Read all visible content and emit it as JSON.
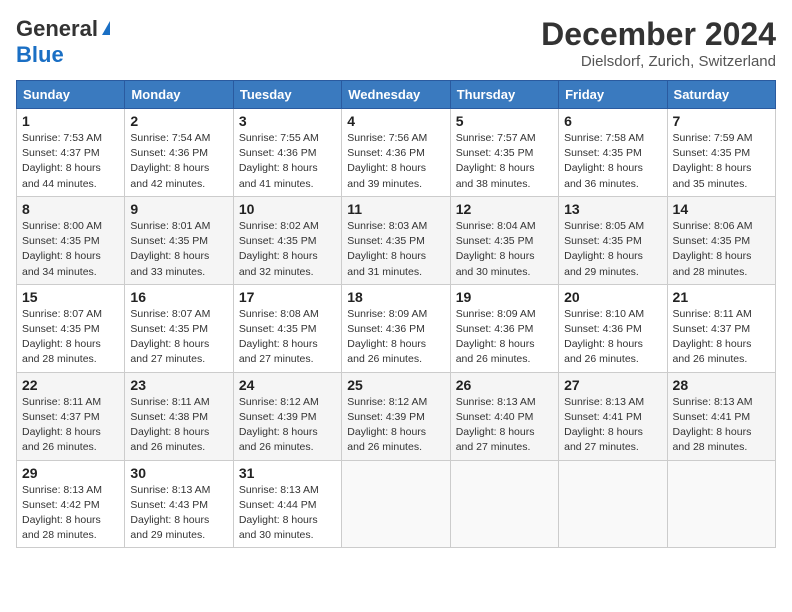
{
  "header": {
    "logo_general": "General",
    "logo_blue": "Blue",
    "month_title": "December 2024",
    "location": "Dielsdorf, Zurich, Switzerland"
  },
  "days_of_week": [
    "Sunday",
    "Monday",
    "Tuesday",
    "Wednesday",
    "Thursday",
    "Friday",
    "Saturday"
  ],
  "weeks": [
    [
      {
        "day": "1",
        "sunrise": "Sunrise: 7:53 AM",
        "sunset": "Sunset: 4:37 PM",
        "daylight": "Daylight: 8 hours and 44 minutes."
      },
      {
        "day": "2",
        "sunrise": "Sunrise: 7:54 AM",
        "sunset": "Sunset: 4:36 PM",
        "daylight": "Daylight: 8 hours and 42 minutes."
      },
      {
        "day": "3",
        "sunrise": "Sunrise: 7:55 AM",
        "sunset": "Sunset: 4:36 PM",
        "daylight": "Daylight: 8 hours and 41 minutes."
      },
      {
        "day": "4",
        "sunrise": "Sunrise: 7:56 AM",
        "sunset": "Sunset: 4:36 PM",
        "daylight": "Daylight: 8 hours and 39 minutes."
      },
      {
        "day": "5",
        "sunrise": "Sunrise: 7:57 AM",
        "sunset": "Sunset: 4:35 PM",
        "daylight": "Daylight: 8 hours and 38 minutes."
      },
      {
        "day": "6",
        "sunrise": "Sunrise: 7:58 AM",
        "sunset": "Sunset: 4:35 PM",
        "daylight": "Daylight: 8 hours and 36 minutes."
      },
      {
        "day": "7",
        "sunrise": "Sunrise: 7:59 AM",
        "sunset": "Sunset: 4:35 PM",
        "daylight": "Daylight: 8 hours and 35 minutes."
      }
    ],
    [
      {
        "day": "8",
        "sunrise": "Sunrise: 8:00 AM",
        "sunset": "Sunset: 4:35 PM",
        "daylight": "Daylight: 8 hours and 34 minutes."
      },
      {
        "day": "9",
        "sunrise": "Sunrise: 8:01 AM",
        "sunset": "Sunset: 4:35 PM",
        "daylight": "Daylight: 8 hours and 33 minutes."
      },
      {
        "day": "10",
        "sunrise": "Sunrise: 8:02 AM",
        "sunset": "Sunset: 4:35 PM",
        "daylight": "Daylight: 8 hours and 32 minutes."
      },
      {
        "day": "11",
        "sunrise": "Sunrise: 8:03 AM",
        "sunset": "Sunset: 4:35 PM",
        "daylight": "Daylight: 8 hours and 31 minutes."
      },
      {
        "day": "12",
        "sunrise": "Sunrise: 8:04 AM",
        "sunset": "Sunset: 4:35 PM",
        "daylight": "Daylight: 8 hours and 30 minutes."
      },
      {
        "day": "13",
        "sunrise": "Sunrise: 8:05 AM",
        "sunset": "Sunset: 4:35 PM",
        "daylight": "Daylight: 8 hours and 29 minutes."
      },
      {
        "day": "14",
        "sunrise": "Sunrise: 8:06 AM",
        "sunset": "Sunset: 4:35 PM",
        "daylight": "Daylight: 8 hours and 28 minutes."
      }
    ],
    [
      {
        "day": "15",
        "sunrise": "Sunrise: 8:07 AM",
        "sunset": "Sunset: 4:35 PM",
        "daylight": "Daylight: 8 hours and 28 minutes."
      },
      {
        "day": "16",
        "sunrise": "Sunrise: 8:07 AM",
        "sunset": "Sunset: 4:35 PM",
        "daylight": "Daylight: 8 hours and 27 minutes."
      },
      {
        "day": "17",
        "sunrise": "Sunrise: 8:08 AM",
        "sunset": "Sunset: 4:35 PM",
        "daylight": "Daylight: 8 hours and 27 minutes."
      },
      {
        "day": "18",
        "sunrise": "Sunrise: 8:09 AM",
        "sunset": "Sunset: 4:36 PM",
        "daylight": "Daylight: 8 hours and 26 minutes."
      },
      {
        "day": "19",
        "sunrise": "Sunrise: 8:09 AM",
        "sunset": "Sunset: 4:36 PM",
        "daylight": "Daylight: 8 hours and 26 minutes."
      },
      {
        "day": "20",
        "sunrise": "Sunrise: 8:10 AM",
        "sunset": "Sunset: 4:36 PM",
        "daylight": "Daylight: 8 hours and 26 minutes."
      },
      {
        "day": "21",
        "sunrise": "Sunrise: 8:11 AM",
        "sunset": "Sunset: 4:37 PM",
        "daylight": "Daylight: 8 hours and 26 minutes."
      }
    ],
    [
      {
        "day": "22",
        "sunrise": "Sunrise: 8:11 AM",
        "sunset": "Sunset: 4:37 PM",
        "daylight": "Daylight: 8 hours and 26 minutes."
      },
      {
        "day": "23",
        "sunrise": "Sunrise: 8:11 AM",
        "sunset": "Sunset: 4:38 PM",
        "daylight": "Daylight: 8 hours and 26 minutes."
      },
      {
        "day": "24",
        "sunrise": "Sunrise: 8:12 AM",
        "sunset": "Sunset: 4:39 PM",
        "daylight": "Daylight: 8 hours and 26 minutes."
      },
      {
        "day": "25",
        "sunrise": "Sunrise: 8:12 AM",
        "sunset": "Sunset: 4:39 PM",
        "daylight": "Daylight: 8 hours and 26 minutes."
      },
      {
        "day": "26",
        "sunrise": "Sunrise: 8:13 AM",
        "sunset": "Sunset: 4:40 PM",
        "daylight": "Daylight: 8 hours and 27 minutes."
      },
      {
        "day": "27",
        "sunrise": "Sunrise: 8:13 AM",
        "sunset": "Sunset: 4:41 PM",
        "daylight": "Daylight: 8 hours and 27 minutes."
      },
      {
        "day": "28",
        "sunrise": "Sunrise: 8:13 AM",
        "sunset": "Sunset: 4:41 PM",
        "daylight": "Daylight: 8 hours and 28 minutes."
      }
    ],
    [
      {
        "day": "29",
        "sunrise": "Sunrise: 8:13 AM",
        "sunset": "Sunset: 4:42 PM",
        "daylight": "Daylight: 8 hours and 28 minutes."
      },
      {
        "day": "30",
        "sunrise": "Sunrise: 8:13 AM",
        "sunset": "Sunset: 4:43 PM",
        "daylight": "Daylight: 8 hours and 29 minutes."
      },
      {
        "day": "31",
        "sunrise": "Sunrise: 8:13 AM",
        "sunset": "Sunset: 4:44 PM",
        "daylight": "Daylight: 8 hours and 30 minutes."
      },
      null,
      null,
      null,
      null
    ]
  ]
}
